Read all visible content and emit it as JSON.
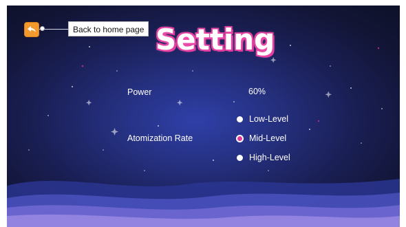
{
  "header": {
    "title": "Setting",
    "back_button_icon": "back-arrow-icon",
    "back_callout": "Back to home page"
  },
  "settings": {
    "power": {
      "label": "Power",
      "value": "60%"
    },
    "atomization": {
      "label": "Atomization Rate",
      "selected": "Mid-Level",
      "options": [
        {
          "label": "Low-Level"
        },
        {
          "label": "Mid-Level"
        },
        {
          "label": "High-Level"
        }
      ]
    }
  },
  "colors": {
    "title_outline": "#e03a9c",
    "back_button": "#f29a2e",
    "background": "#1a1f55"
  }
}
